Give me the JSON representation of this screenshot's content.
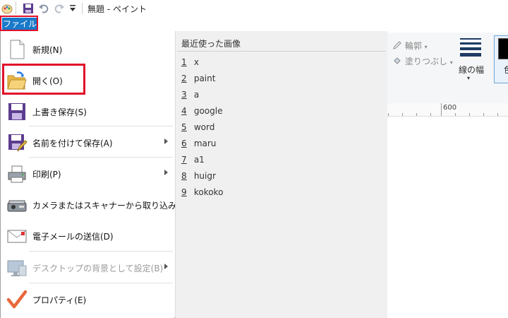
{
  "window": {
    "title": "無題 - ペイント"
  },
  "quick_access": {
    "icons": [
      "paint-app-icon",
      "save-icon",
      "undo-icon",
      "redo-icon",
      "customize-dropdown-icon"
    ]
  },
  "ribbon": {
    "file_tab": "ファイル",
    "outline_label": "輪郭",
    "fill_label": "塗りつぶし",
    "line_width_label": "線の幅",
    "color_label": "色",
    "ruler_value": "600"
  },
  "file_menu": {
    "items": [
      {
        "label": "新規(N)",
        "icon": "new-document-icon",
        "submenu": false,
        "enabled": true
      },
      {
        "label": "開く(O)",
        "icon": "open-folder-icon",
        "submenu": false,
        "enabled": true,
        "highlighted": true
      },
      {
        "label": "上書き保存(S)",
        "icon": "save-icon",
        "submenu": false,
        "enabled": true
      },
      {
        "label": "名前を付けて保存(A)",
        "icon": "save-as-icon",
        "submenu": true,
        "enabled": true
      },
      {
        "label": "印刷(P)",
        "icon": "printer-icon",
        "submenu": true,
        "enabled": true
      },
      {
        "label": "カメラまたはスキャナーから取り込み(M)",
        "icon": "scanner-icon",
        "submenu": false,
        "enabled": true
      },
      {
        "label": "電子メールの送信(D)",
        "icon": "email-icon",
        "submenu": false,
        "enabled": true
      },
      {
        "label": "デスクトップの背景として設定(B)",
        "icon": "desktop-background-icon",
        "submenu": true,
        "enabled": false
      },
      {
        "label": "プロパティ(E)",
        "icon": "properties-checkmark-icon",
        "submenu": false,
        "enabled": true
      }
    ],
    "recent_header": "最近使った画像",
    "recent": [
      {
        "num": "1",
        "name": "x"
      },
      {
        "num": "2",
        "name": "paint"
      },
      {
        "num": "3",
        "name": "a"
      },
      {
        "num": "4",
        "name": "google"
      },
      {
        "num": "5",
        "name": "word"
      },
      {
        "num": "6",
        "name": "maru"
      },
      {
        "num": "7",
        "name": "a1"
      },
      {
        "num": "8",
        "name": "huigr"
      },
      {
        "num": "9",
        "name": "kokoko"
      }
    ]
  },
  "colors": {
    "file_tab_bg": "#1979ca",
    "highlight_red": "#e0102a",
    "menu_right_bg": "#f0f0f0"
  }
}
